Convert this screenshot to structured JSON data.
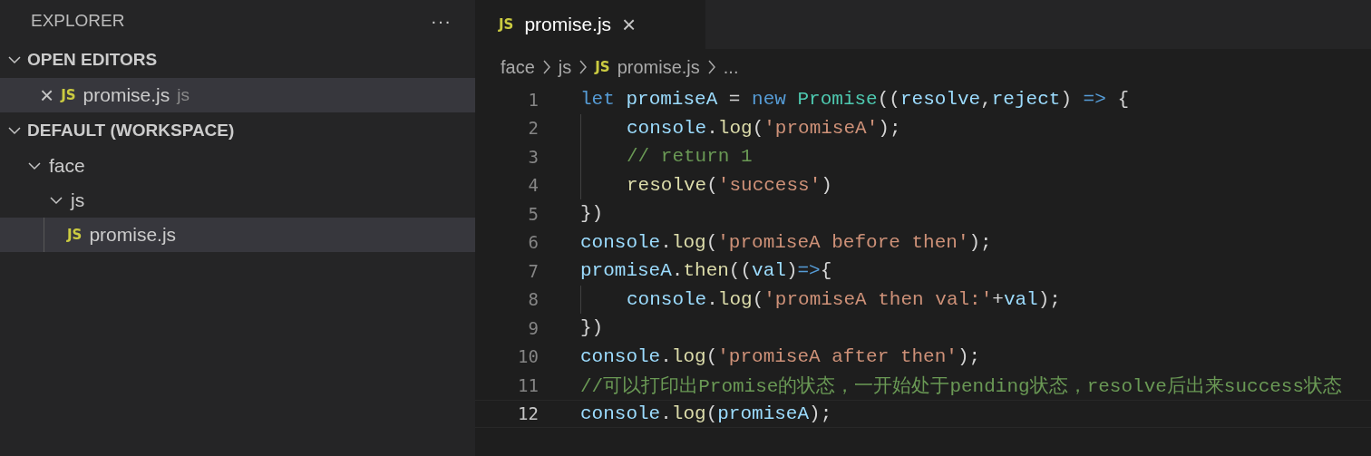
{
  "sidebar": {
    "title": "EXPLORER",
    "more": "···",
    "sections": [
      {
        "label": "OPEN EDITORS",
        "expanded": true,
        "kind": "editors",
        "items": [
          {
            "close": "×",
            "badge": "JS",
            "name": "promise.js",
            "detail": "js",
            "selected": true
          }
        ]
      },
      {
        "label": "DEFAULT (WORKSPACE)",
        "expanded": true,
        "kind": "tree",
        "items": [
          {
            "name": "face",
            "kind": "folder",
            "expanded": true,
            "selected": false,
            "children": [
              {
                "name": "js",
                "kind": "folder",
                "expanded": true,
                "selected": false,
                "children": [
                  {
                    "name": "promise.js",
                    "kind": "file",
                    "badge": "JS",
                    "selected": true
                  }
                ]
              }
            ]
          }
        ]
      }
    ]
  },
  "tabs": [
    {
      "badge": "JS",
      "label": "promise.js",
      "close": "×",
      "selected": true
    }
  ],
  "breadcrumbs": [
    {
      "label": "face"
    },
    {
      "label": "js"
    },
    {
      "label": "promise.js",
      "badge": "JS"
    },
    {
      "label": "..."
    }
  ],
  "code": [
    {
      "number": "1",
      "indented": false,
      "current": false,
      "tokens": [
        {
          "kind": "kw",
          "text": "let "
        },
        {
          "kind": "var",
          "text": "promiseA"
        },
        {
          "kind": "plain",
          "text": " = "
        },
        {
          "kind": "kw",
          "text": "new "
        },
        {
          "kind": "cls",
          "text": "Promise"
        },
        {
          "kind": "plain",
          "text": "(("
        },
        {
          "kind": "var",
          "text": "resolve"
        },
        {
          "kind": "plain",
          "text": ","
        },
        {
          "kind": "var",
          "text": "reject"
        },
        {
          "kind": "plain",
          "text": ") "
        },
        {
          "kind": "kw",
          "text": "=>"
        },
        {
          "kind": "plain",
          "text": " {"
        }
      ]
    },
    {
      "number": "2",
      "indented": true,
      "current": false,
      "tokens": [
        {
          "kind": "var",
          "text": "console"
        },
        {
          "kind": "plain",
          "text": "."
        },
        {
          "kind": "fn",
          "text": "log"
        },
        {
          "kind": "plain",
          "text": "("
        },
        {
          "kind": "str",
          "text": "'promiseA'"
        },
        {
          "kind": "plain",
          "text": ");"
        }
      ]
    },
    {
      "number": "3",
      "indented": true,
      "current": false,
      "tokens": [
        {
          "kind": "cmt",
          "text": "// return 1"
        }
      ]
    },
    {
      "number": "4",
      "indented": true,
      "current": false,
      "tokens": [
        {
          "kind": "fn",
          "text": "resolve"
        },
        {
          "kind": "plain",
          "text": "("
        },
        {
          "kind": "str",
          "text": "'success'"
        },
        {
          "kind": "plain",
          "text": ")"
        }
      ]
    },
    {
      "number": "5",
      "indented": false,
      "current": false,
      "tokens": [
        {
          "kind": "plain",
          "text": "})"
        }
      ]
    },
    {
      "number": "6",
      "indented": false,
      "current": false,
      "tokens": [
        {
          "kind": "var",
          "text": "console"
        },
        {
          "kind": "plain",
          "text": "."
        },
        {
          "kind": "fn",
          "text": "log"
        },
        {
          "kind": "plain",
          "text": "("
        },
        {
          "kind": "str",
          "text": "'promiseA before then'"
        },
        {
          "kind": "plain",
          "text": ");"
        }
      ]
    },
    {
      "number": "7",
      "indented": false,
      "current": false,
      "tokens": [
        {
          "kind": "var",
          "text": "promiseA"
        },
        {
          "kind": "plain",
          "text": "."
        },
        {
          "kind": "fn",
          "text": "then"
        },
        {
          "kind": "plain",
          "text": "(("
        },
        {
          "kind": "var",
          "text": "val"
        },
        {
          "kind": "plain",
          "text": ")"
        },
        {
          "kind": "kw",
          "text": "=>"
        },
        {
          "kind": "plain",
          "text": "{"
        }
      ]
    },
    {
      "number": "8",
      "indented": true,
      "current": false,
      "tokens": [
        {
          "kind": "var",
          "text": "console"
        },
        {
          "kind": "plain",
          "text": "."
        },
        {
          "kind": "fn",
          "text": "log"
        },
        {
          "kind": "plain",
          "text": "("
        },
        {
          "kind": "str",
          "text": "'promiseA then val:'"
        },
        {
          "kind": "plain",
          "text": "+"
        },
        {
          "kind": "var",
          "text": "val"
        },
        {
          "kind": "plain",
          "text": ");"
        }
      ]
    },
    {
      "number": "9",
      "indented": false,
      "current": false,
      "tokens": [
        {
          "kind": "plain",
          "text": "})"
        }
      ]
    },
    {
      "number": "10",
      "indented": false,
      "current": false,
      "tokens": [
        {
          "kind": "var",
          "text": "console"
        },
        {
          "kind": "plain",
          "text": "."
        },
        {
          "kind": "fn",
          "text": "log"
        },
        {
          "kind": "plain",
          "text": "("
        },
        {
          "kind": "str",
          "text": "'promiseA after then'"
        },
        {
          "kind": "plain",
          "text": ");"
        }
      ]
    },
    {
      "number": "11",
      "indented": false,
      "current": false,
      "tokens": [
        {
          "kind": "cmt",
          "text": "//可以打印出Promise的状态，一开始处于pending状态，resolve后出来success状态"
        }
      ]
    },
    {
      "number": "12",
      "indented": false,
      "current": true,
      "tokens": [
        {
          "kind": "var",
          "text": "console"
        },
        {
          "kind": "plain",
          "text": "."
        },
        {
          "kind": "fn",
          "text": "log"
        },
        {
          "kind": "plain",
          "text": "("
        },
        {
          "kind": "var",
          "text": "promiseA"
        },
        {
          "kind": "plain",
          "text": ");"
        }
      ]
    }
  ]
}
